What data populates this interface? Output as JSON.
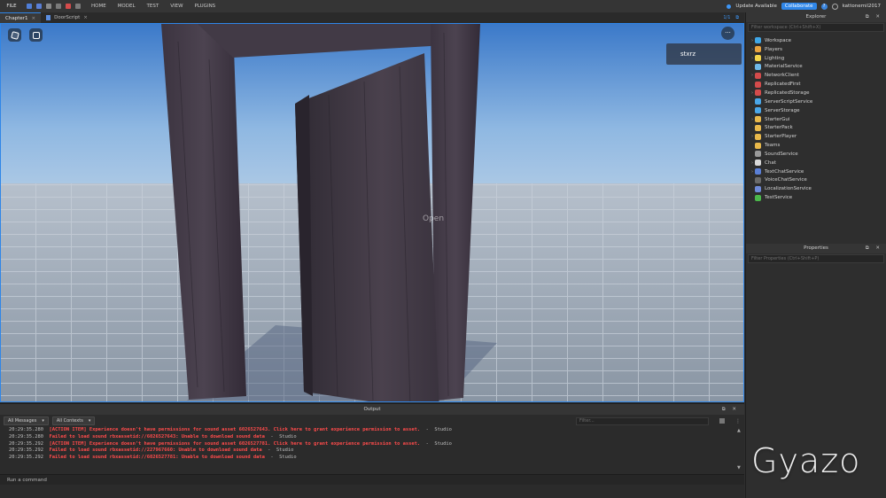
{
  "topbar": {
    "file": "FILE",
    "menu": [
      "HOME",
      "MODEL",
      "TEST",
      "VIEW",
      "PLUGINS"
    ],
    "update": "Update Available",
    "collaborate": "Collaborate",
    "help": "?",
    "username": "kattonemil2017"
  },
  "tabs": [
    {
      "label": "Chapter1",
      "close": "×",
      "active": true
    },
    {
      "label": "DoorScript",
      "close": "×",
      "active": false
    }
  ],
  "tabs_right": "1/1",
  "viewport": {
    "player_name": "stxrz",
    "prompt_text": "Open",
    "more": "···"
  },
  "explorer": {
    "title": "Explorer",
    "filter_placeholder": "Filter workspace (Ctrl+Shift+X)",
    "items": [
      {
        "label": "Workspace",
        "arrow": "›",
        "color": "#3fa7e8"
      },
      {
        "label": "Players",
        "arrow": "›",
        "color": "#e8a33f"
      },
      {
        "label": "Lighting",
        "arrow": "›",
        "color": "#f2d34a"
      },
      {
        "label": "MaterialService",
        "arrow": "",
        "color": "#6fb8e8"
      },
      {
        "label": "NetworkClient",
        "arrow": "›",
        "color": "#d44b4b"
      },
      {
        "label": "ReplicatedFirst",
        "arrow": "",
        "color": "#d44b4b"
      },
      {
        "label": "ReplicatedStorage",
        "arrow": "›",
        "color": "#d44b4b"
      },
      {
        "label": "ServerScriptService",
        "arrow": "",
        "color": "#4aa6e8"
      },
      {
        "label": "ServerStorage",
        "arrow": "",
        "color": "#4aa6e8"
      },
      {
        "label": "StarterGui",
        "arrow": "›",
        "color": "#e8b84a"
      },
      {
        "label": "StarterPack",
        "arrow": "",
        "color": "#e8b84a"
      },
      {
        "label": "StarterPlayer",
        "arrow": "›",
        "color": "#e8b84a"
      },
      {
        "label": "Teams",
        "arrow": "",
        "color": "#e8b84a"
      },
      {
        "label": "SoundService",
        "arrow": "",
        "color": "#9a9a9a"
      },
      {
        "label": "Chat",
        "arrow": "›",
        "color": "#d8d8d8"
      },
      {
        "label": "TextChatService",
        "arrow": "›",
        "color": "#5a7fd6"
      },
      {
        "label": "VoiceChatService",
        "arrow": "",
        "color": "#6a6a6a"
      },
      {
        "label": "LocalizationService",
        "arrow": "",
        "color": "#6f8ad8"
      },
      {
        "label": "TestService",
        "arrow": "",
        "color": "#4bb84b"
      }
    ]
  },
  "properties": {
    "title": "Properties",
    "filter_placeholder": "Filter Properties (Ctrl+Shift+P)"
  },
  "panel_controls": "⧉ ✕",
  "output": {
    "title": "Output",
    "filter_all_messages": "All Messages",
    "filter_all_contexts": "All Contexts",
    "filter_placeholder": "Filter...",
    "lines": [
      {
        "ts": "20:29:35.280",
        "msg": "[ACTION ITEM] Experience doesn't have permissions for sound asset 6026527643. Click here to grant experience permission to asset.",
        "src": "-  Studio"
      },
      {
        "ts": "20:29:35.280",
        "msg": "Failed to load sound rbxassetid://6026527643: Unable to download sound data",
        "src": "-  Studio"
      },
      {
        "ts": "20:29:35.292",
        "msg": "[ACTION ITEM] Experience doesn't have permissions for sound asset 6026527781. Click here to grant experience permission to asset.",
        "src": "-  Studio"
      },
      {
        "ts": "20:29:35.292",
        "msg": "Failed to load sound rbxassetid://227967660: Unable to download sound data",
        "src": "-  Studio"
      },
      {
        "ts": "20:29:35.292",
        "msg": "Failed to load sound rbxassetid://6026527781: Unable to download sound data",
        "src": "-  Studio"
      }
    ],
    "command_placeholder": "Run a command"
  },
  "watermark": "Gyazo"
}
